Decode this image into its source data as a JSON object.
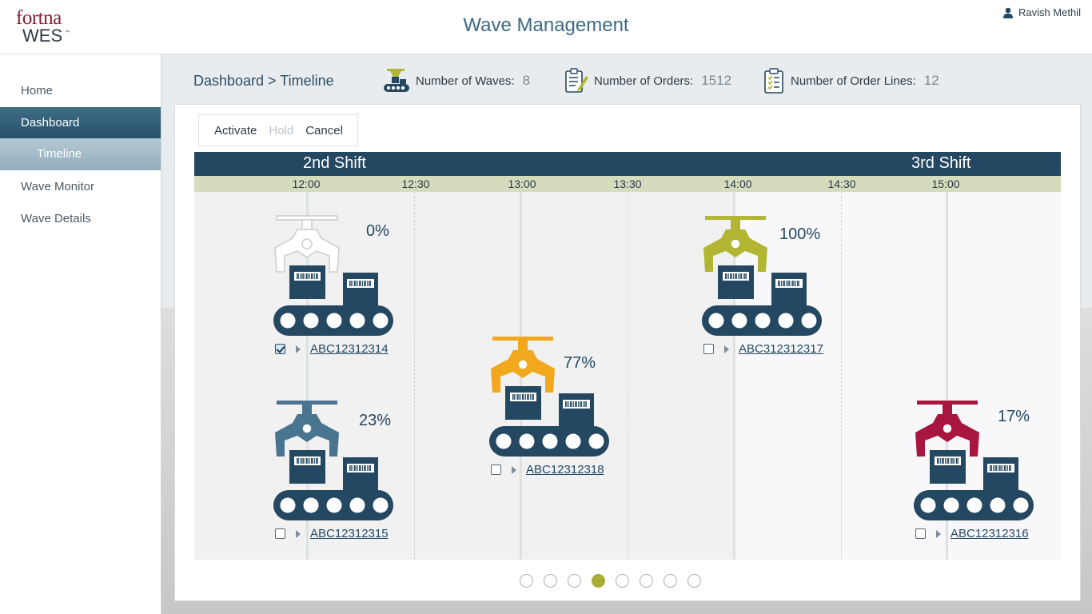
{
  "header": {
    "logo_line1": "fortna",
    "logo_line2": "WES",
    "logo_tm": "™",
    "title": "Wave Management",
    "user_name": "Ravish Methil"
  },
  "sidebar": {
    "items": [
      {
        "label": "Home"
      },
      {
        "label": "Dashboard",
        "active": true
      },
      {
        "label": "Timeline",
        "sub": true
      },
      {
        "label": "Wave Monitor"
      },
      {
        "label": "Wave Details"
      }
    ]
  },
  "breadcrumb": "Dashboard > Timeline",
  "stats": {
    "waves_label": "Number of Waves:",
    "waves_value": "8",
    "orders_label": "Number of Orders:",
    "orders_value": "1512",
    "lines_label": "Number of Order Lines:",
    "lines_value": "12"
  },
  "actions": {
    "activate": "Activate",
    "hold": "Hold",
    "cancel": "Cancel"
  },
  "timeline": {
    "shifts": [
      "2nd Shift",
      "3rd Shift"
    ],
    "times": [
      "12:00",
      "12:30",
      "13:00",
      "13:30",
      "14:00",
      "14:30",
      "15:00"
    ]
  },
  "waves": [
    {
      "id": "ABC12312314",
      "percent": "0%",
      "color": "#ffffff",
      "checked": true
    },
    {
      "id": "ABC12312315",
      "percent": "23%",
      "color": "#4a7590",
      "checked": false
    },
    {
      "id": "ABC12312318",
      "percent": "77%",
      "color": "#f2a81d",
      "checked": false
    },
    {
      "id": "ABC312312317",
      "percent": "100%",
      "color": "#b2b632",
      "checked": false
    },
    {
      "id": "ABC12312316",
      "percent": "17%",
      "color": "#a8163f",
      "checked": false
    }
  ],
  "colors": {
    "dark": "#244861",
    "accent": "#a8ad33"
  },
  "pager": {
    "count": 8,
    "active": 4
  }
}
